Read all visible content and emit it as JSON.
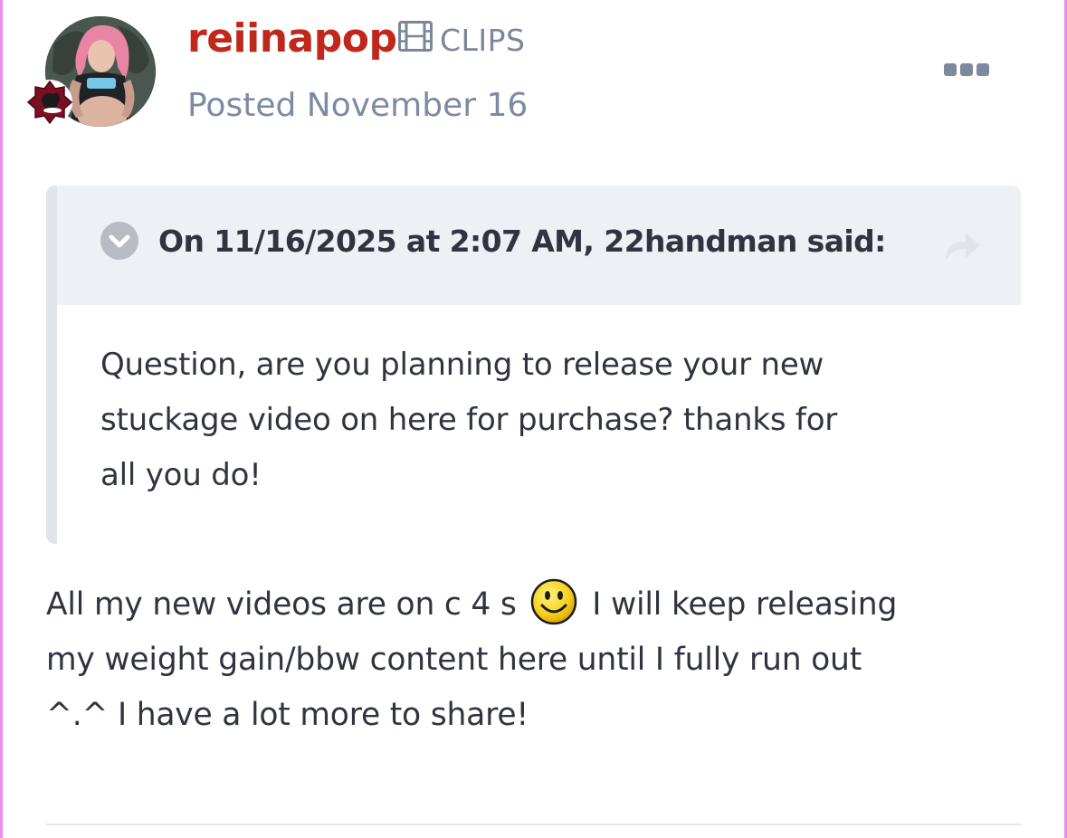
{
  "post": {
    "author": {
      "username": "reiinapop",
      "group_icon": "film-icon",
      "group": "CLIPS",
      "avatar_alt": "user-avatar"
    },
    "posted_label": "Posted November 16",
    "more_icon": "ellipsis-icon"
  },
  "quote": {
    "citation": "On 11/16/2025 at 2:07 AM, 22handman said:",
    "lines": [
      "Question, are you planning to release your new",
      "stuckage video on here for purchase? thanks for",
      "all you do!"
    ]
  },
  "body": {
    "line1_before_emoji": "All my new videos are on c 4 s",
    "emoji": "smiley-emoji",
    "line1_after_emoji": "I will keep releasing",
    "line2": "my weight gain/bbw content here until I fully run out",
    "line3": "^.^ I have a lot more to share!"
  },
  "colors": {
    "username": "#c0281c",
    "meta": "#7d8aa3",
    "quote_header_bg": "#edf0f4",
    "quote_border": "#e1e4e8",
    "page_edge": "#ea8cf0"
  }
}
